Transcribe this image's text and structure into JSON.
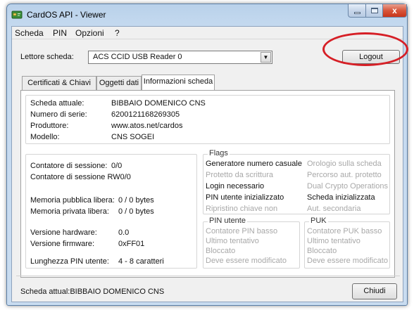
{
  "window": {
    "title": "CardOS API - Viewer",
    "close_glyph": "x"
  },
  "menu": {
    "items": [
      "Scheda",
      "PIN",
      "Opzioni",
      "?"
    ]
  },
  "reader": {
    "label": "Lettore scheda:",
    "selected": "ACS CCID USB Reader 0",
    "logout_label": "Logout"
  },
  "tabs": [
    {
      "label": "Certificati & Chiavi",
      "active": false
    },
    {
      "label": "Oggetti dati",
      "active": false
    },
    {
      "label": "Informazioni scheda",
      "active": true
    }
  ],
  "card_info": {
    "rows": [
      {
        "label": "Scheda attuale:",
        "value": "BIBBAIO DOMENICO CNS"
      },
      {
        "label": "Numero di serie:",
        "value": "6200121168269305"
      },
      {
        "label": "Produttore:",
        "value": "www.atos.net/cardos"
      },
      {
        "label": "Modello:",
        "value": "CNS SOGEI"
      }
    ]
  },
  "stats": {
    "session_counter_label": "Contatore di sessione:",
    "session_counter_value": "0/0",
    "session_counter_rw": "Contatore di sessione RW0/0",
    "public_mem_label": "Memoria pubblica libera:",
    "public_mem_value": "0 / 0 bytes",
    "private_mem_label": "Memoria privata libera:",
    "private_mem_value": "0 / 0 bytes",
    "hw_version_label": "Versione hardware:",
    "hw_version_value": "0.0",
    "fw_version_label": "Versione firmware:",
    "fw_version_value": "0xFF01",
    "pin_length_label": "Lunghezza PIN utente:",
    "pin_length_value": "4 - 8 caratteri"
  },
  "flags": {
    "title": "Flags",
    "left": [
      {
        "text": "Generatore numero casuale",
        "enabled": true
      },
      {
        "text": "Protetto da scrittura",
        "enabled": false
      },
      {
        "text": "Login necessario",
        "enabled": true
      },
      {
        "text": "PIN utente inizializzato",
        "enabled": true
      },
      {
        "text": "Ripristino chiave non",
        "enabled": false
      }
    ],
    "right": [
      {
        "text": "Orologio sulla scheda",
        "enabled": false
      },
      {
        "text": "Percorso aut. protetto",
        "enabled": false
      },
      {
        "text": "Dual Crypto Operations",
        "enabled": false
      },
      {
        "text": "Scheda inizializzata",
        "enabled": true
      },
      {
        "text": "Aut. secondaria",
        "enabled": false
      }
    ]
  },
  "pin_user": {
    "title": "PIN utente",
    "items": [
      "Contatore PIN basso",
      "Ultimo tentativo",
      "Bloccato",
      "Deve essere modificato"
    ]
  },
  "puk": {
    "title": "PUK",
    "items": [
      "Contatore PUK basso",
      "Ultimo tentativo",
      "Bloccato",
      "Deve essere modificato"
    ]
  },
  "footer": {
    "status": "Scheda attual:BIBBAIO DOMENICO CNS",
    "close_label": "Chiudi"
  },
  "colors": {
    "highlight_ellipse": "#d61f26",
    "disabled_text": "#a8a8a8"
  }
}
